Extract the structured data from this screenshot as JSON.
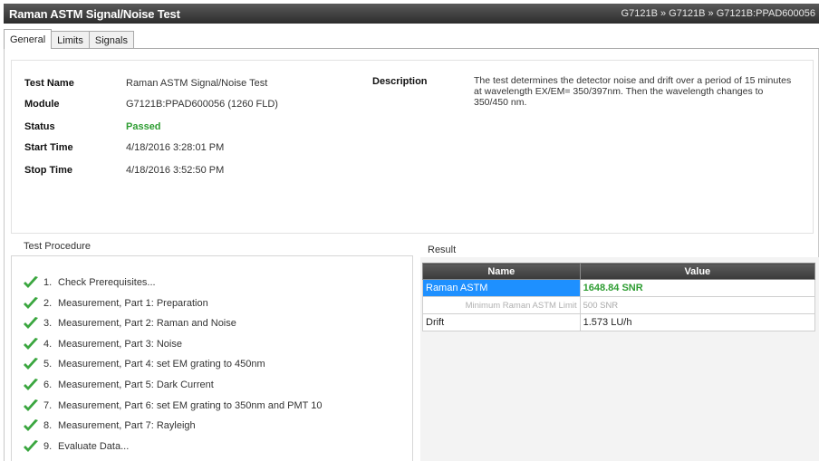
{
  "window": {
    "title": "Raman ASTM Signal/Noise Test",
    "path": "G7121B » G7121B » G7121B:PPAD600056"
  },
  "tabs": [
    {
      "label": "General",
      "active": true
    },
    {
      "label": "Limits",
      "active": false
    },
    {
      "label": "Signals",
      "active": false
    }
  ],
  "info": {
    "test_name_label": "Test Name",
    "test_name": "Raman ASTM Signal/Noise Test",
    "module_label": "Module",
    "module": "G7121B:PPAD600056 (1260 FLD)",
    "status_label": "Status",
    "status": "Passed",
    "start_label": "Start Time",
    "start": "4/18/2016 3:28:01 PM",
    "stop_label": "Stop Time",
    "stop": "4/18/2016 3:52:50 PM",
    "description_label": "Description",
    "description": "The test determines the detector noise and drift over a period of 15 minutes at wavelength EX/EM= 350/397nm. Then the wavelength changes to 350/450 nm."
  },
  "procedure": {
    "title": "Test Procedure",
    "steps": [
      {
        "num": "1.",
        "label": "Check Prerequisites..."
      },
      {
        "num": "2.",
        "label": "Measurement, Part 1: Preparation"
      },
      {
        "num": "3.",
        "label": "Measurement, Part 2: Raman and Noise"
      },
      {
        "num": "4.",
        "label": "Measurement, Part 3: Noise"
      },
      {
        "num": "5.",
        "label": "Measurement, Part 4: set EM grating to 450nm"
      },
      {
        "num": "6.",
        "label": "Measurement, Part 5: Dark Current"
      },
      {
        "num": "7.",
        "label": "Measurement, Part 6: set EM grating to 350nm and PMT 10"
      },
      {
        "num": "8.",
        "label": "Measurement, Part 7: Rayleigh"
      },
      {
        "num": "9.",
        "label": "Evaluate Data..."
      }
    ],
    "check_color": "#3aa63f"
  },
  "result": {
    "title": "Result",
    "col_name": "Name",
    "col_value": "Value",
    "rows": [
      {
        "name": "Raman ASTM",
        "value": "1648.84 SNR"
      },
      {
        "name": "Minimum Raman ASTM Limit",
        "value": "500 SNR"
      },
      {
        "name": "Drift",
        "value": "1.573 LU/h"
      }
    ]
  },
  "colors": {
    "titlebar": "#3a3a3a",
    "passed": "#2e9d32",
    "selection": "#1e90ff"
  }
}
